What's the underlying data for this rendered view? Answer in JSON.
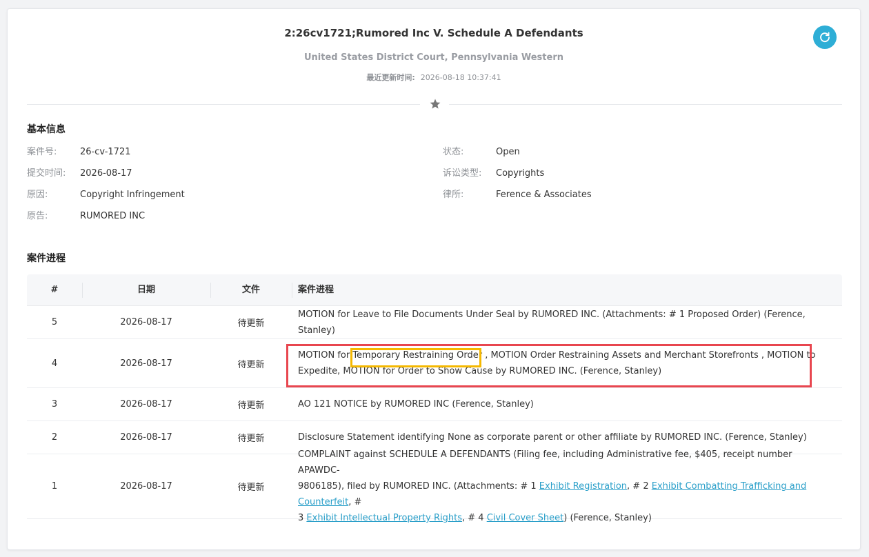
{
  "case_header": {
    "title": "2:26cv1721;Rumored Inc V. Schedule A Defendants",
    "court": "United States District Court, Pennsylvania Western",
    "update_label": "最近更新时间:",
    "update_time": "2026-08-18 10:37:41"
  },
  "icons": {
    "refresh": "refresh-icon",
    "divider": "star-icon"
  },
  "colors": {
    "accent": "#2eaed6",
    "link": "#2a9fc9",
    "highlight_red": "#e8464f",
    "highlight_yellow": "#f5b800"
  },
  "basic_info": {
    "title": "基本信息",
    "left": [
      {
        "label": "案件号:",
        "value": "26-cv-1721"
      },
      {
        "label": "提交时间:",
        "value": "2026-08-17"
      },
      {
        "label": "原因:",
        "value": "Copyright Infringement"
      },
      {
        "label": "原告:",
        "value": "RUMORED INC"
      }
    ],
    "right": [
      {
        "label": "状态:",
        "value": "Open"
      },
      {
        "label": "诉讼类型:",
        "value": "Copyrights"
      },
      {
        "label": "律所:",
        "value": "Ference & Associates"
      }
    ]
  },
  "progress": {
    "title": "案件进程",
    "columns": [
      "#",
      "日期",
      "文件",
      "案件进程"
    ],
    "rows": [
      {
        "num": "5",
        "date": "2026-08-17",
        "file": "待更新",
        "text": "MOTION for Leave to File Documents Under Seal by RUMORED INC. (Attachments: # 1 Proposed Order) (Ference, Stanley)"
      },
      {
        "num": "4",
        "date": "2026-08-17",
        "file": "待更新",
        "text_line1": "MOTION for Temporary Restraining Order , MOTION Order Restraining Assets and Merchant Storefronts , MOTION to",
        "text_line2": "Expedite, MOTION for Order to Show Cause by RUMORED INC. (Ference, Stanley)"
      },
      {
        "num": "3",
        "date": "2026-08-17",
        "file": "待更新",
        "text": "AO 121 NOTICE by RUMORED INC (Ference, Stanley)"
      },
      {
        "num": "2",
        "date": "2026-08-17",
        "file": "待更新",
        "text": "Disclosure Statement identifying None as corporate parent or other affiliate by RUMORED INC. (Ference, Stanley)"
      },
      {
        "num": "1",
        "date": "2026-08-17",
        "file": "待更新",
        "line1": "COMPLAINT against SCHEDULE A DEFENDANTS (Filing fee, including Administrative fee, $405, receipt number APAWDC-",
        "line2_pre": "9806185), filed by RUMORED INC. (Attachments: # 1 ",
        "link1": "Exhibit Registration",
        "line2_mid": ", # 2 ",
        "link2": "Exhibit Combatting Trafficking and Counterfeit",
        "line2_post": ", #",
        "line3_pre": "3 ",
        "link3": "Exhibit Intellectual Property Rights",
        "line3_mid": ", # 4 ",
        "link4": "Civil Cover Sheet",
        "line3_post": ") (Ference, Stanley)"
      }
    ]
  }
}
